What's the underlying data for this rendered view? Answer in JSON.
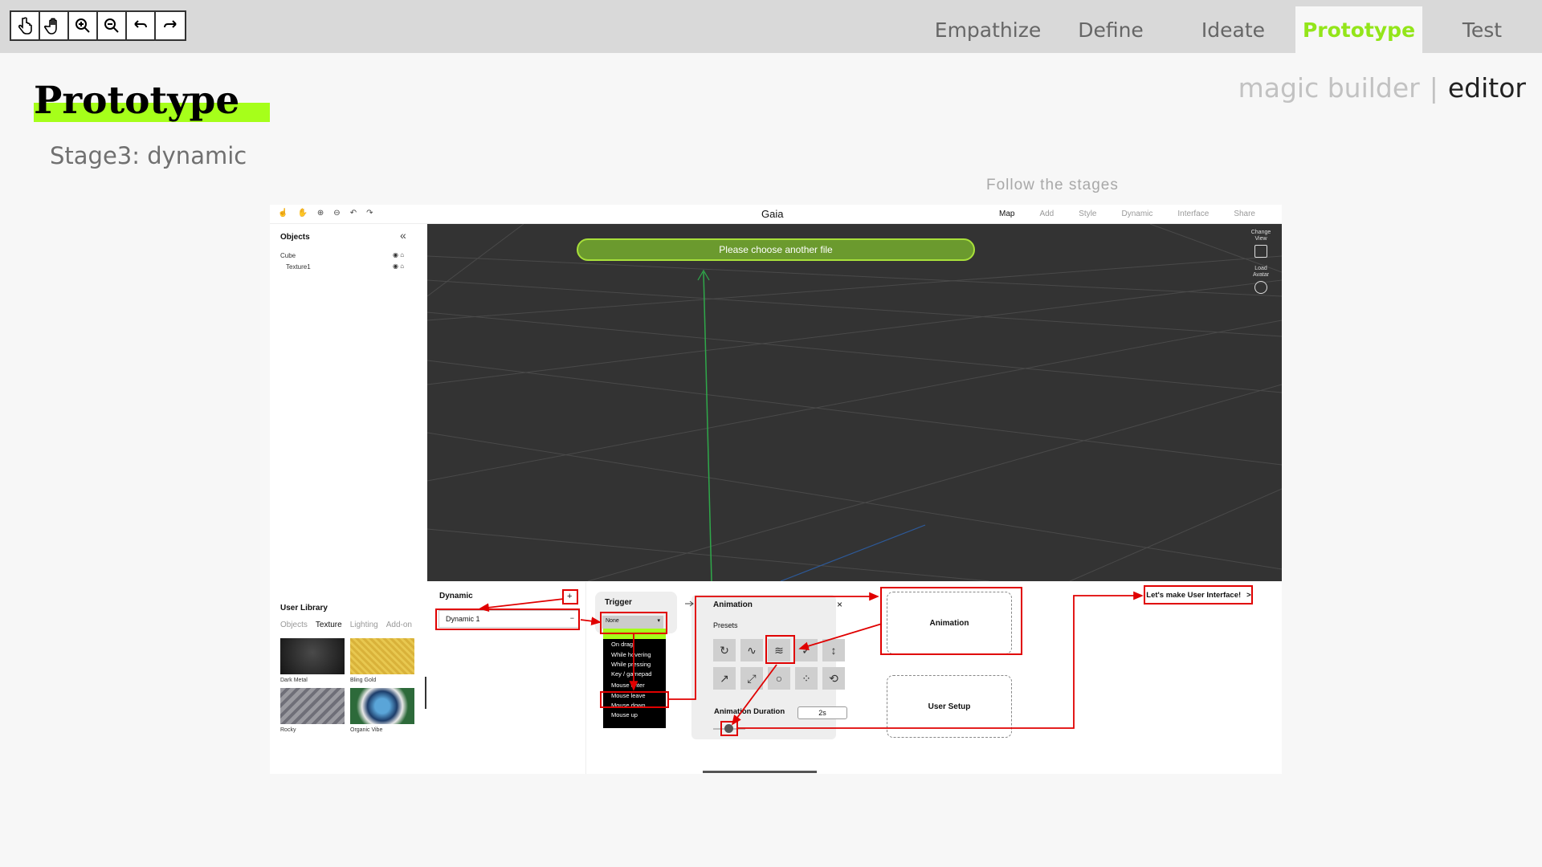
{
  "toolbar": {
    "tools": [
      "pointer-hand-icon",
      "pan-hand-icon",
      "zoom-in-icon",
      "zoom-out-icon",
      "undo-icon",
      "redo-icon"
    ]
  },
  "tabs": [
    {
      "label": "Empathize",
      "active": false
    },
    {
      "label": "Define",
      "active": false
    },
    {
      "label": "Ideate",
      "active": false
    },
    {
      "label": "Prototype",
      "active": true
    },
    {
      "label": "Test",
      "active": false
    }
  ],
  "accent_color": "#a6ff1a",
  "page": {
    "title": "Prototype",
    "stage": "Stage3: dynamic",
    "mode_inactive": "magic builder",
    "mode_separator": "|",
    "mode_active": "editor",
    "follow": "Follow the stages"
  },
  "screenshot": {
    "app_title": "Gaia",
    "nav": [
      "Map",
      "Add",
      "Style",
      "Dynamic",
      "Interface",
      "Share"
    ],
    "nav_active": "Map",
    "objects_title": "Objects",
    "objects": [
      "Cube",
      "Texture1"
    ],
    "banner": "Please choose another file",
    "viewport_side": {
      "change_view": "Change View",
      "load_avatar": "Load Avatar"
    },
    "library_title": "User Library",
    "library_tabs": [
      "Objects",
      "Texture",
      "Lighting",
      "Add-on"
    ],
    "library_active_tab": "Texture",
    "textures": [
      "Dark Metal",
      "Bling Gold",
      "Rocky",
      "Organic Vibe"
    ],
    "dynamic_title": "Dynamic",
    "dynamic_add": "+",
    "dynamic_item": "Dynamic 1",
    "dynamic_remove": "−",
    "trigger_title": "Trigger",
    "trigger_selected": "None",
    "trigger_options": [
      "On click",
      "On drag",
      "While hovering",
      "While pressing",
      "Key / gamepad",
      "Mouse enter",
      "Mouse leave",
      "Mouse down",
      "Mouse up"
    ],
    "animation_title": "Animation",
    "animation_close": "×",
    "presets_label": "Presets",
    "presets": [
      "rotate-icon",
      "bounce-icon",
      "wave-icon",
      "check-icon",
      "vertical-icon",
      "diagonal-icon",
      "expand-icon",
      "circle-icon",
      "sparkle-icon",
      "loop-icon"
    ],
    "duration_label": "Animation Duration",
    "duration_value": "2s",
    "card_animation": "Animation",
    "card_user_setup": "User Setup",
    "next_button": "Let's make User Interface!",
    "next_chevron": ">"
  }
}
